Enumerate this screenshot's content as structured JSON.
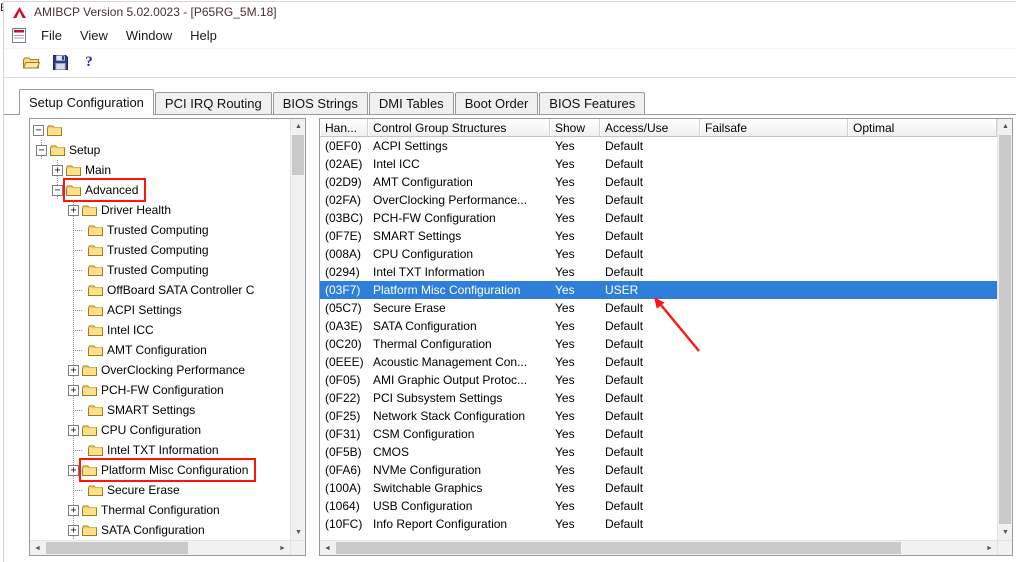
{
  "window": {
    "title": "AMIBCP Version 5.02.0023 - [P65RG_5M.18]",
    "background_artifact": "E"
  },
  "menu": {
    "items": [
      "File",
      "View",
      "Window",
      "Help"
    ]
  },
  "toolbar": {
    "buttons": [
      "open",
      "save",
      "help"
    ],
    "help_glyph": "?"
  },
  "tabs": [
    "Setup Configuration",
    "PCI IRQ Routing",
    "BIOS Strings",
    "DMI Tables",
    "Boot Order",
    "BIOS Features"
  ],
  "tree": {
    "items": [
      {
        "depth": 0,
        "expander": "minus",
        "label": ""
      },
      {
        "depth": 1,
        "expander": "minus",
        "label": "Setup"
      },
      {
        "depth": 2,
        "expander": "plus",
        "label": "Main"
      },
      {
        "depth": 2,
        "expander": "minus",
        "label": "Advanced",
        "boxed": true
      },
      {
        "depth": 3,
        "expander": "plus",
        "label": "Driver Health"
      },
      {
        "depth": 3,
        "expander": null,
        "label": "Trusted Computing"
      },
      {
        "depth": 3,
        "expander": null,
        "label": "Trusted Computing"
      },
      {
        "depth": 3,
        "expander": null,
        "label": "Trusted Computing"
      },
      {
        "depth": 3,
        "expander": null,
        "label": "OffBoard SATA Controller C"
      },
      {
        "depth": 3,
        "expander": null,
        "label": "ACPI Settings"
      },
      {
        "depth": 3,
        "expander": null,
        "label": "Intel ICC"
      },
      {
        "depth": 3,
        "expander": null,
        "label": "AMT Configuration"
      },
      {
        "depth": 3,
        "expander": "plus",
        "label": "OverClocking Performance"
      },
      {
        "depth": 3,
        "expander": "plus",
        "label": "PCH-FW Configuration"
      },
      {
        "depth": 3,
        "expander": null,
        "label": "SMART Settings"
      },
      {
        "depth": 3,
        "expander": "plus",
        "label": "CPU Configuration"
      },
      {
        "depth": 3,
        "expander": null,
        "label": "Intel TXT Information"
      },
      {
        "depth": 3,
        "expander": "plus",
        "label": "Platform Misc Configuration",
        "boxed": true
      },
      {
        "depth": 3,
        "expander": null,
        "label": "Secure Erase"
      },
      {
        "depth": 3,
        "expander": "plus",
        "label": "Thermal Configuration"
      },
      {
        "depth": 3,
        "expander": "plus",
        "label": "SATA Configuration"
      }
    ]
  },
  "table": {
    "columns": [
      "Han...",
      "Control Group Structures",
      "Show",
      "Access/Use",
      "Failsafe",
      "Optimal"
    ],
    "rows": [
      {
        "handle": "(0EF0)",
        "name": "ACPI Settings",
        "show": "Yes",
        "access": "Default"
      },
      {
        "handle": "(02AE)",
        "name": "Intel ICC",
        "show": "Yes",
        "access": "Default"
      },
      {
        "handle": "(02D9)",
        "name": "AMT Configuration",
        "show": "Yes",
        "access": "Default"
      },
      {
        "handle": "(02FA)",
        "name": "OverClocking Performance...",
        "show": "Yes",
        "access": "Default"
      },
      {
        "handle": "(03BC)",
        "name": "PCH-FW Configuration",
        "show": "Yes",
        "access": "Default"
      },
      {
        "handle": "(0F7E)",
        "name": "SMART Settings",
        "show": "Yes",
        "access": "Default"
      },
      {
        "handle": "(008A)",
        "name": "CPU Configuration",
        "show": "Yes",
        "access": "Default"
      },
      {
        "handle": "(0294)",
        "name": "Intel TXT Information",
        "show": "Yes",
        "access": "Default"
      },
      {
        "handle": "(03F7)",
        "name": "Platform Misc Configuration",
        "show": "Yes",
        "access": "USER",
        "selected": true
      },
      {
        "handle": "(05C7)",
        "name": "Secure Erase",
        "show": "Yes",
        "access": "Default"
      },
      {
        "handle": "(0A3E)",
        "name": "SATA Configuration",
        "show": "Yes",
        "access": "Default"
      },
      {
        "handle": "(0C20)",
        "name": "Thermal Configuration",
        "show": "Yes",
        "access": "Default"
      },
      {
        "handle": "(0EEE)",
        "name": "Acoustic Management Con...",
        "show": "Yes",
        "access": "Default"
      },
      {
        "handle": "(0F05)",
        "name": "AMI Graphic Output Protoc...",
        "show": "Yes",
        "access": "Default"
      },
      {
        "handle": "(0F22)",
        "name": "PCI Subsystem Settings",
        "show": "Yes",
        "access": "Default"
      },
      {
        "handle": "(0F25)",
        "name": "Network Stack Configuration",
        "show": "Yes",
        "access": "Default"
      },
      {
        "handle": "(0F31)",
        "name": "CSM Configuration",
        "show": "Yes",
        "access": "Default"
      },
      {
        "handle": "(0F5B)",
        "name": "CMOS",
        "show": "Yes",
        "access": "Default"
      },
      {
        "handle": "(0FA6)",
        "name": "NVMe Configuration",
        "show": "Yes",
        "access": "Default"
      },
      {
        "handle": "(100A)",
        "name": "Switchable Graphics",
        "show": "Yes",
        "access": "Default"
      },
      {
        "handle": "(1064)",
        "name": "USB Configuration",
        "show": "Yes",
        "access": "Default"
      },
      {
        "handle": "(10FC)",
        "name": "Info Report Configuration",
        "show": "Yes",
        "access": "Default"
      }
    ]
  },
  "colors": {
    "selection": "#2e7fd9",
    "annotation": "#ff1410"
  }
}
